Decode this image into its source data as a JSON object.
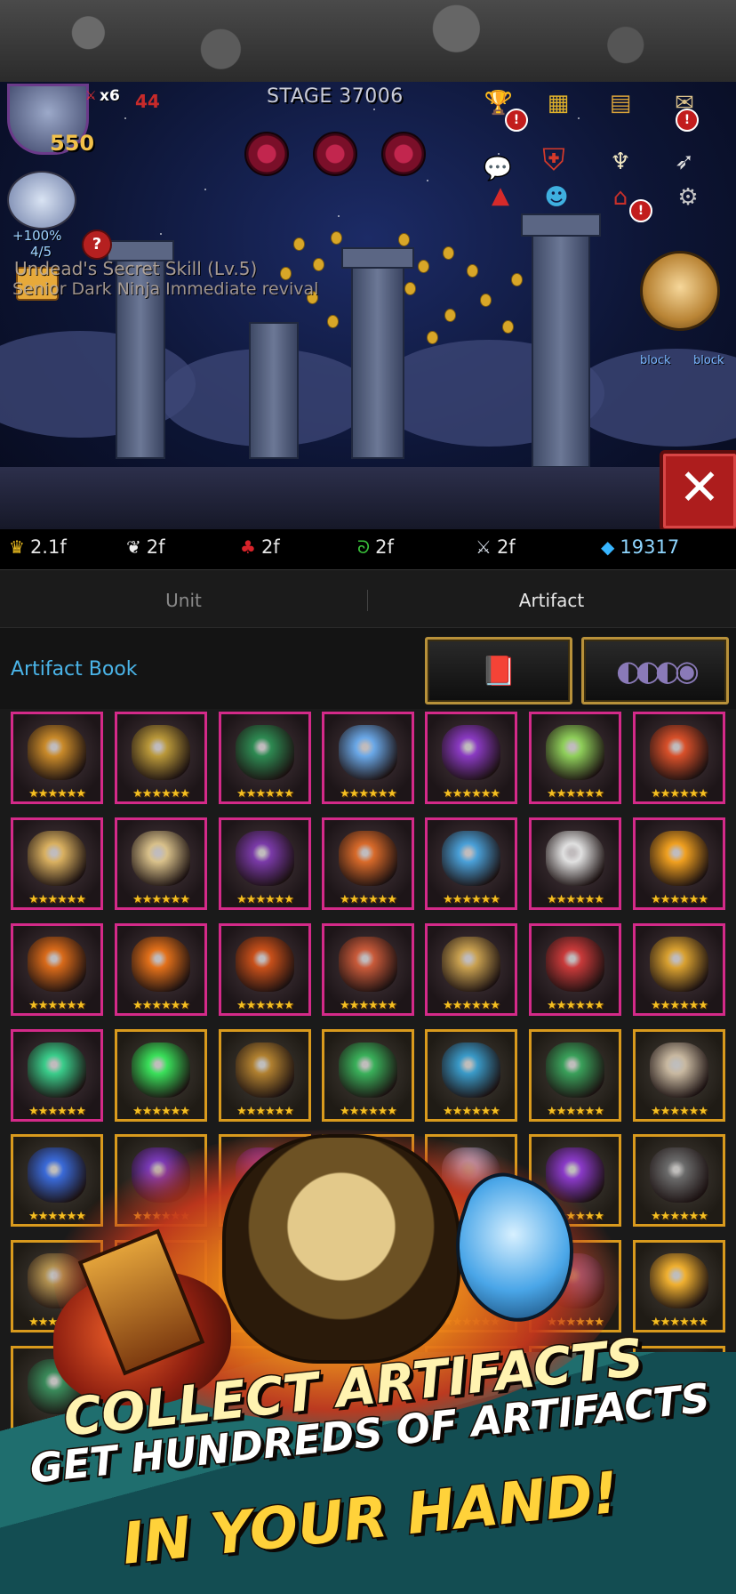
{
  "hud": {
    "hero_level": "550",
    "multiplier": "x6",
    "multiplier_red": "44",
    "stage": "STAGE 37006",
    "pet_percent": "+100%",
    "pet_count": "4/5",
    "help": "?"
  },
  "skill_notice": {
    "title": "Undead's Secret Skill (Lv.5)",
    "subtitle": "Senior Dark Ninja Immediate revival"
  },
  "block_tags": [
    "block",
    "block"
  ],
  "close_label": "✕",
  "resources": [
    {
      "icon": "crown-icon",
      "glyph": "♛",
      "value": "2.1f"
    },
    {
      "icon": "feather-icon",
      "glyph": "❦",
      "value": "2f"
    },
    {
      "icon": "cherry-icon",
      "glyph": "♣",
      "value": "2f"
    },
    {
      "icon": "sprout-icon",
      "glyph": "ᘐ",
      "value": "2f"
    },
    {
      "icon": "dagger-icon",
      "glyph": "⚔",
      "value": "2f"
    },
    {
      "icon": "gem-icon",
      "glyph": "◆",
      "value": "19317"
    }
  ],
  "tabs": {
    "unit": "Unit",
    "artifact": "Artifact"
  },
  "artifact_book": {
    "title": "Artifact Book"
  },
  "stars": "★★★★★★",
  "grid_colors": {
    "legend_border": "#d42a89",
    "epic_border": "#d99a1d",
    "star": "#f4bf22"
  },
  "promo": {
    "line1": "COLLECT ARTIFACTS",
    "line2": "GET HUNDREDS OF ARTIFACTS",
    "line3": "IN YOUR HAND!"
  }
}
